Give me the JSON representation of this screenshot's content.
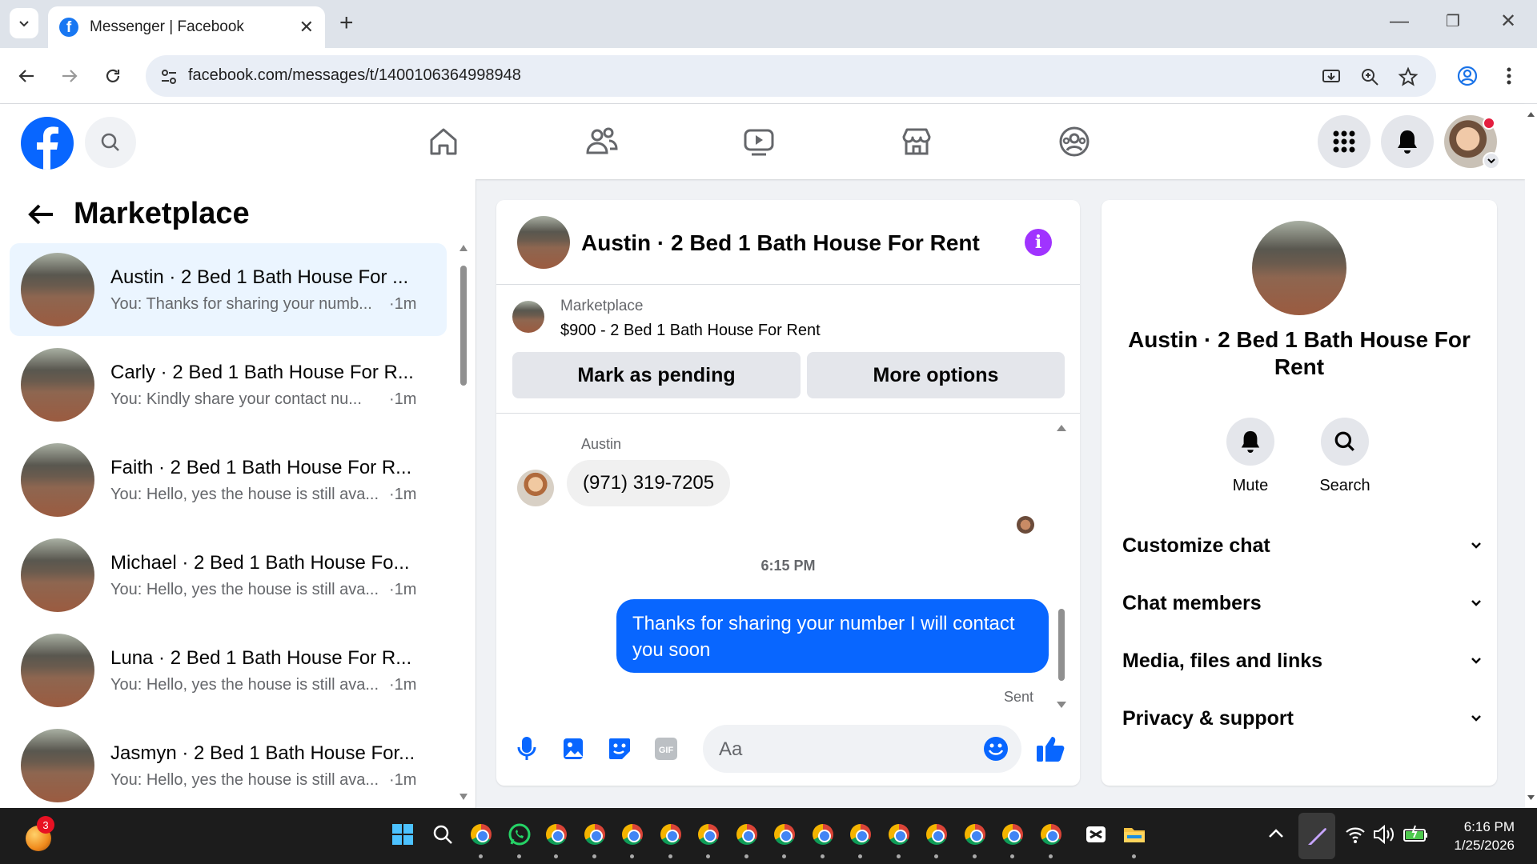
{
  "browser": {
    "tab_title": "Messenger | Facebook",
    "url": "facebook.com/messages/t/1400106364998948"
  },
  "left": {
    "title": "Marketplace",
    "conversations": [
      {
        "name": "Austin · 2 Bed 1 Bath House For ...",
        "preview": "You: Thanks for sharing your numb...",
        "time": "·1m",
        "active": true
      },
      {
        "name": "Carly · 2 Bed 1 Bath House For R...",
        "preview": "You: Kindly share your contact nu...",
        "time": "·1m"
      },
      {
        "name": "Faith · 2 Bed 1 Bath House For R...",
        "preview": "You: Hello, yes the house is still ava...",
        "time": "·1m"
      },
      {
        "name": "Michael · 2 Bed 1 Bath House Fo...",
        "preview": "You: Hello, yes the house is still ava...",
        "time": "·1m"
      },
      {
        "name": "Luna · 2 Bed 1 Bath House For R...",
        "preview": "You: Hello, yes the house is still ava...",
        "time": "·1m"
      },
      {
        "name": "Jasmyn · 2 Bed 1 Bath House For...",
        "preview": "You: Hello, yes the house is still ava...",
        "time": "·1m"
      }
    ]
  },
  "chat": {
    "title": "Austin · 2 Bed 1 Bath House For Rent",
    "marketplace_label": "Marketplace",
    "listing": "$900 - 2 Bed 1 Bath House For Rent",
    "btn_pending": "Mark as pending",
    "btn_more": "More options",
    "sender": "Austin",
    "incoming": "(971) 319-7205",
    "timestamp": "6:15 PM",
    "outgoing": "Thanks for sharing your number I will contact you soon",
    "status": "Sent",
    "placeholder": "Aa"
  },
  "info": {
    "name": "Austin · 2 Bed 1 Bath House For Rent",
    "mute": "Mute",
    "search": "Search",
    "sections": [
      "Customize chat",
      "Chat members",
      "Media, files and links",
      "Privacy & support"
    ]
  },
  "taskbar": {
    "badge": "3",
    "time": "6:16 PM",
    "date": "1/25/2026"
  },
  "colors": {
    "fb_blue": "#0866ff",
    "active_row": "#ebf5ff",
    "info_purple": "#a033ff"
  }
}
